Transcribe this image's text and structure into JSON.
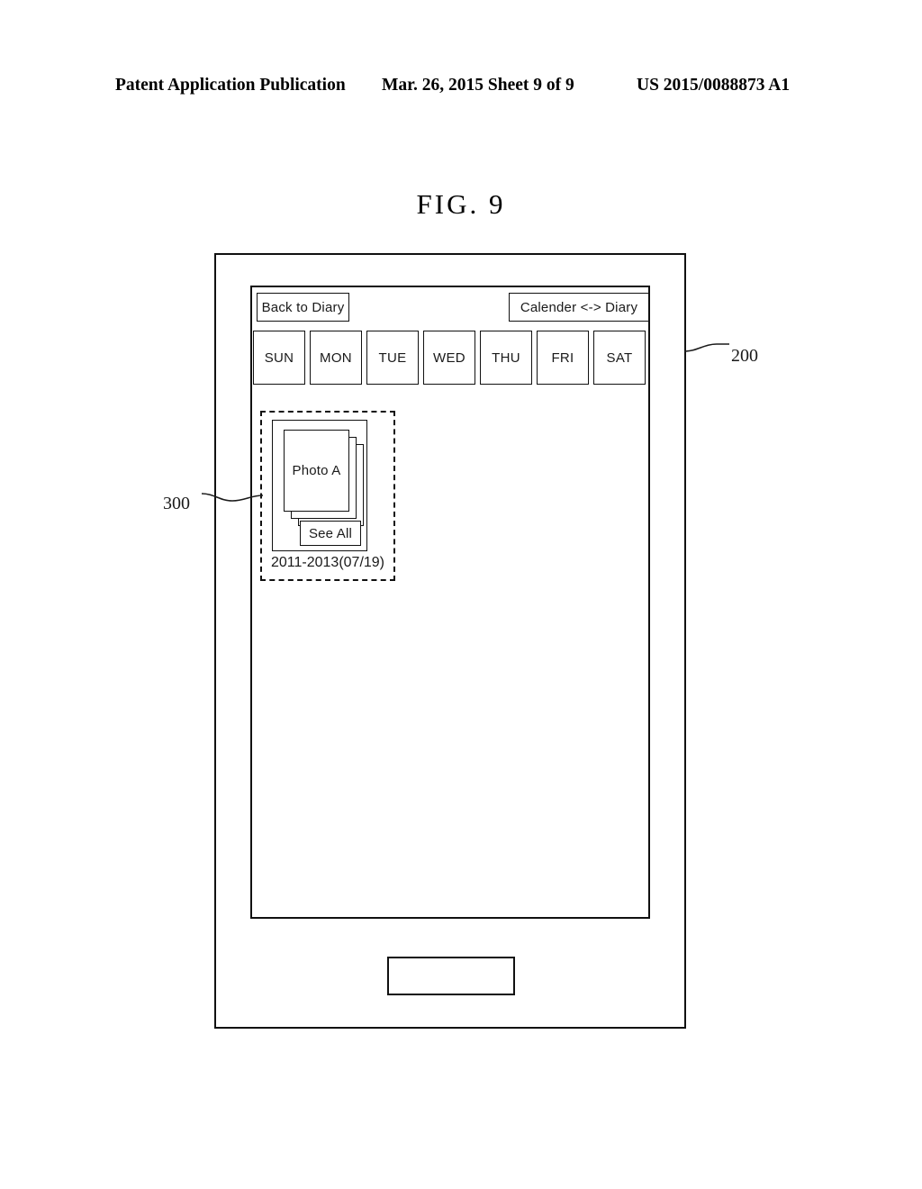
{
  "header": {
    "left": "Patent Application Publication",
    "middle": "Mar. 26, 2015  Sheet 9 of 9",
    "right": "US 2015/0088873 A1"
  },
  "figure": {
    "title": "FIG.  9"
  },
  "reference_numerals": {
    "device": "200",
    "photo_group": "300"
  },
  "screen": {
    "toolbar": {
      "back_label": "Back to Diary",
      "toggle_label": "Calender <-> Diary"
    },
    "weekdays": [
      {
        "label": "SUN"
      },
      {
        "label": "MON"
      },
      {
        "label": "TUE"
      },
      {
        "label": "WED"
      },
      {
        "label": "THU"
      },
      {
        "label": "FRI"
      },
      {
        "label": "SAT"
      }
    ],
    "photo_group": {
      "front_card_label": "Photo A",
      "see_all_label": "See All",
      "date_label": "2011-2013(07/19)"
    }
  }
}
